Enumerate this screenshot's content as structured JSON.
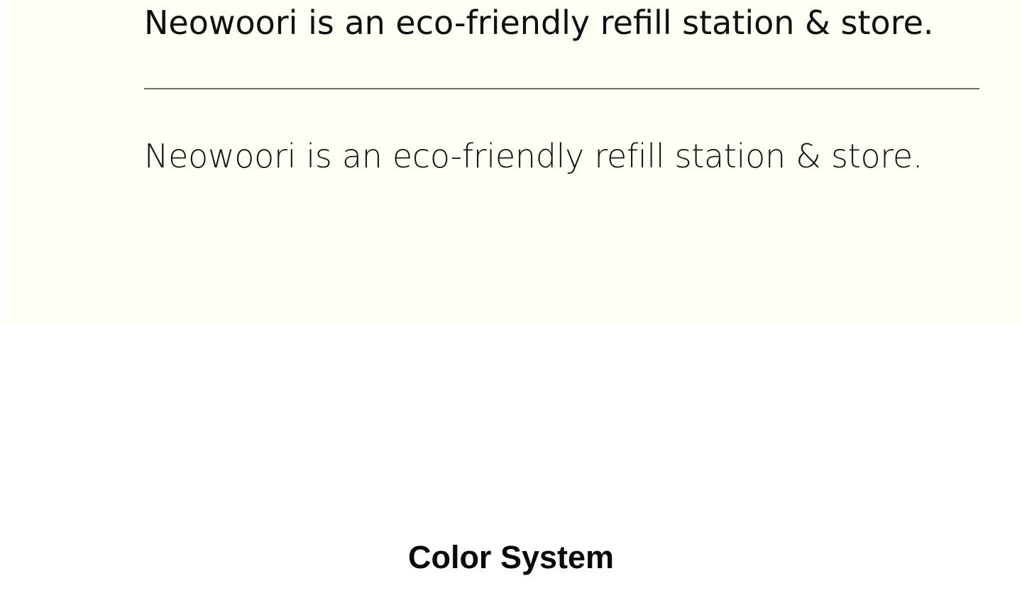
{
  "typography": {
    "sample_medium": "Neowoori is an eco-friendly refill station & store.",
    "sample_light": "Neowoori is an eco-friendly refill station & store.",
    "background_color": "#fffff6",
    "divider_color": "#6b6f69"
  },
  "section": {
    "title": "Color System"
  }
}
